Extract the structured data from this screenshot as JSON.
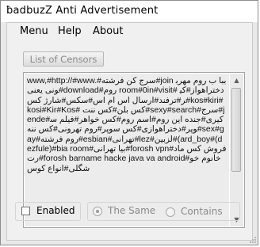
{
  "window": {
    "title": "ƀadbuzZ Anti Advertisement"
  },
  "menu": {
    "items": [
      "Menu",
      "Help",
      "About"
    ]
  },
  "toolbar": {
    "list_of_censors_label": "List of Censors"
  },
  "censor_list": {
    "text": "www,#http://#www.#سرج کن فرشته#join ببا ب روم  مهربونی یعنی#download#روم room#0in#visit# دختراهواز#کیر#ترفند#ارسال اس ام اس#سکس#شارژ کس#kos#kiri#kosi#Kir#Kos# کس بلن#کس ننت#sexy#search#سرج#jende#کیری#جنده این روم#اسم روم#کس خواهر#فیلم سوپر#دختراهوازی#کس سوپر#روم تهرونی#کس ننه#sex#gay#روم فرشته#esbian#تهرانی#lez#لزبین#(ard_boy#(dezfule)#bia  room#بیا تهرانی#forosh vpn#فروش کس مادرت#forosh barname hacke java va  android#خانوم خوشگلی#انواع کوس"
  },
  "options": {
    "enabled_label": "Enabled",
    "enabled_checked": false,
    "the_same_label": "The Same",
    "the_same_selected": true,
    "contains_label": "Contains",
    "contains_selected": false
  },
  "colors": {
    "window_bg": "#e9e9e9",
    "client_bg": "#f0f0f0",
    "textarea_bg": "#ececec",
    "disabled_text": "#8a8a8a"
  }
}
